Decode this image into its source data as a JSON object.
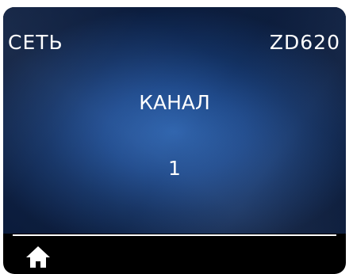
{
  "header": {
    "menu_label": "СЕТЬ",
    "model_label": "ZD620"
  },
  "main": {
    "setting_title": "КАНАЛ",
    "setting_value": "1"
  },
  "footer": {
    "home_icon": "home-icon"
  },
  "colors": {
    "background_center": "#2e67b6",
    "background_edge": "#0b1d3f",
    "text": "#ffffff",
    "bezel": "#000000"
  }
}
